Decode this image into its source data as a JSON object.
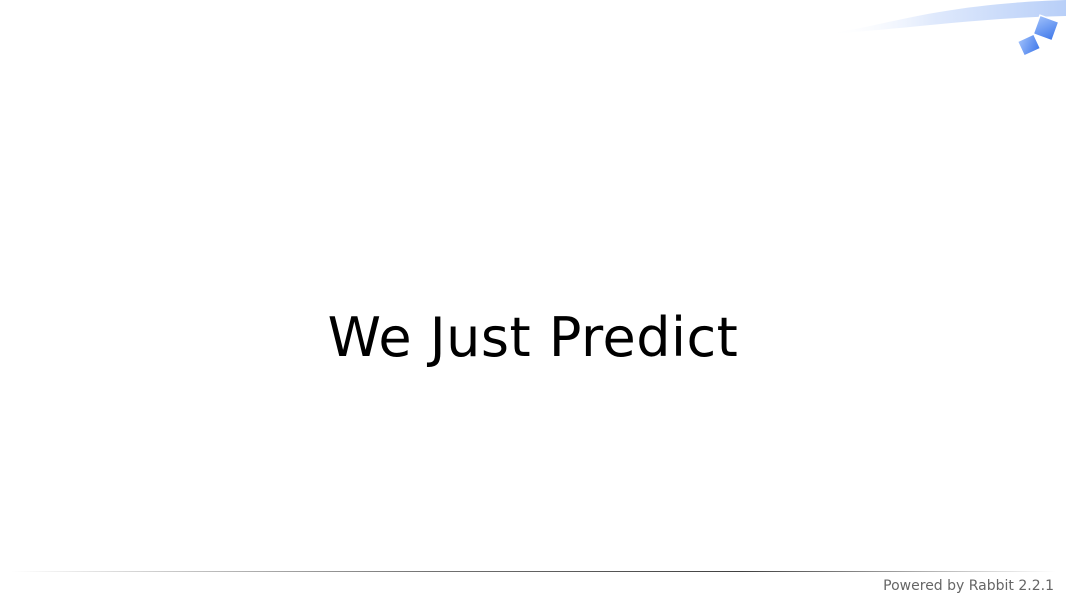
{
  "slide": {
    "title": "We Just Predict"
  },
  "footer": {
    "powered_by": "Powered by Rabbit 2.2.1"
  },
  "decoration": {
    "icon": "rabbit-corner-logo-icon",
    "accent_color": "#4a84f0",
    "swoosh_color": "#bcd3fb"
  }
}
